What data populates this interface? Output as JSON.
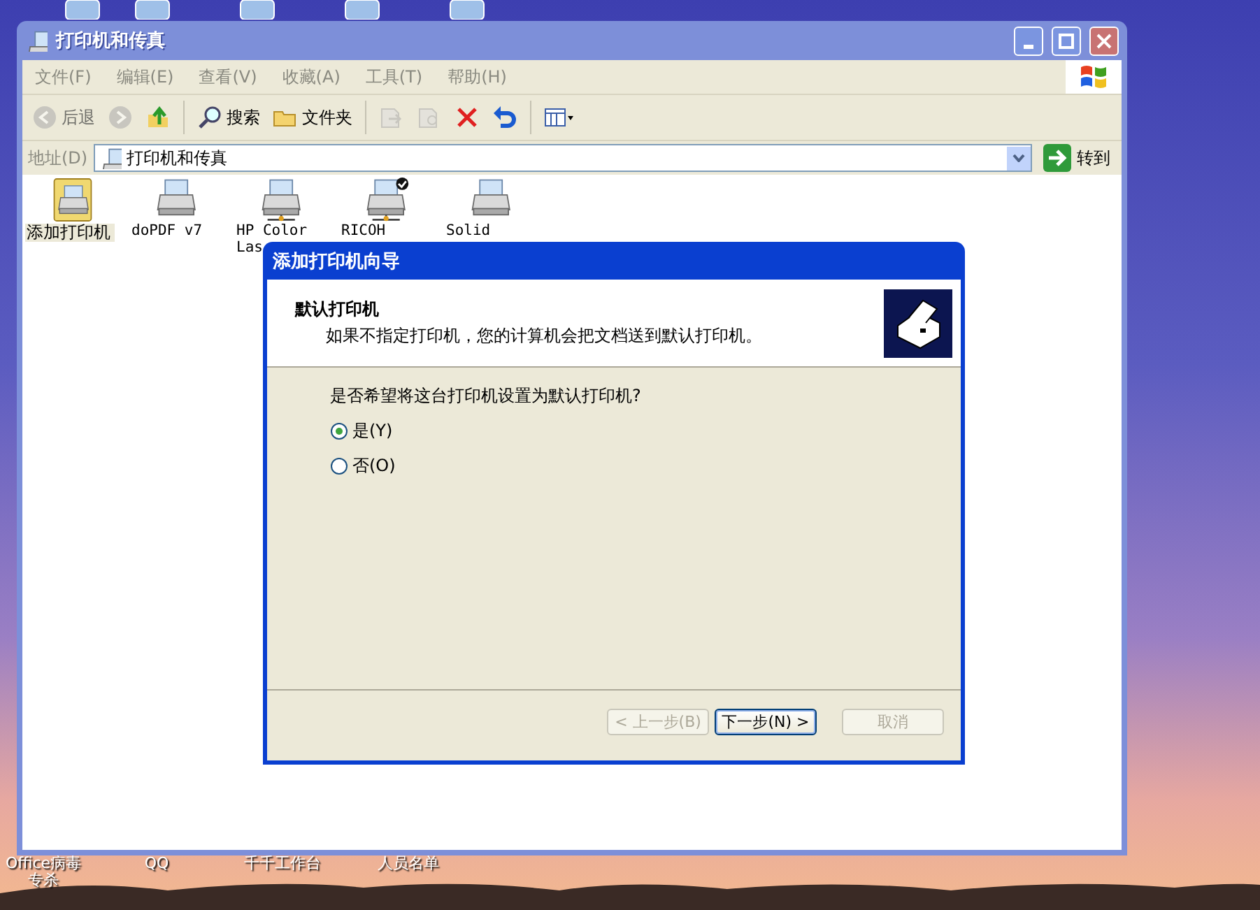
{
  "explorer": {
    "title": "打印机和传真",
    "menu": [
      {
        "label": "文件(F)"
      },
      {
        "label": "编辑(E)"
      },
      {
        "label": "查看(V)"
      },
      {
        "label": "收藏(A)"
      },
      {
        "label": "工具(T)"
      },
      {
        "label": "帮助(H)"
      }
    ],
    "toolbar": [
      {
        "kind": "back",
        "label": "后退",
        "disabled": true
      },
      {
        "kind": "forward",
        "disabled": true
      },
      {
        "kind": "up",
        "disabled": false
      },
      {
        "kind": "sep"
      },
      {
        "kind": "search",
        "label": "搜索",
        "disabled": false
      },
      {
        "kind": "folders",
        "label": "文件夹",
        "disabled": false
      },
      {
        "kind": "sep"
      },
      {
        "kind": "move",
        "disabled": true
      },
      {
        "kind": "copy",
        "disabled": true
      },
      {
        "kind": "delete",
        "disabled": false
      },
      {
        "kind": "undo",
        "disabled": false
      },
      {
        "kind": "sep"
      },
      {
        "kind": "views",
        "disabled": false
      }
    ],
    "address": {
      "label": "地址(D)",
      "value": "打印机和传真",
      "go": "转到"
    },
    "items": [
      {
        "kind": "add",
        "label": "添加打印机",
        "selected": true
      },
      {
        "kind": "printer",
        "label": "doPDF v7",
        "selected": false,
        "default": false
      },
      {
        "kind": "network",
        "label": "HP Color Las",
        "selected": false,
        "default": false
      },
      {
        "kind": "network",
        "label": "RICOH",
        "selected": false,
        "default": true
      },
      {
        "kind": "printer",
        "label": "Solid",
        "selected": false,
        "default": false
      }
    ]
  },
  "wizard": {
    "title": "添加打印机向导",
    "heading": "默认打印机",
    "subheading": "如果不指定打印机，您的计算机会把文档送到默认打印机。",
    "question": "是否希望将这台打印机设置为默认打印机?",
    "options": [
      {
        "label": "是(Y)",
        "selected": true
      },
      {
        "label": "否(O)",
        "selected": false
      }
    ],
    "buttons": [
      {
        "label": "< 上一步(B)",
        "disabled": true,
        "default": false
      },
      {
        "label": "下一步(N) >",
        "disabled": false,
        "default": true
      },
      {
        "label": "取消",
        "disabled": true,
        "default": false
      }
    ]
  },
  "desktop_labels": [
    {
      "label": "Office病毒专杀"
    },
    {
      "label": "QQ"
    },
    {
      "label": "千千工作台"
    },
    {
      "label": "人员名单"
    }
  ]
}
